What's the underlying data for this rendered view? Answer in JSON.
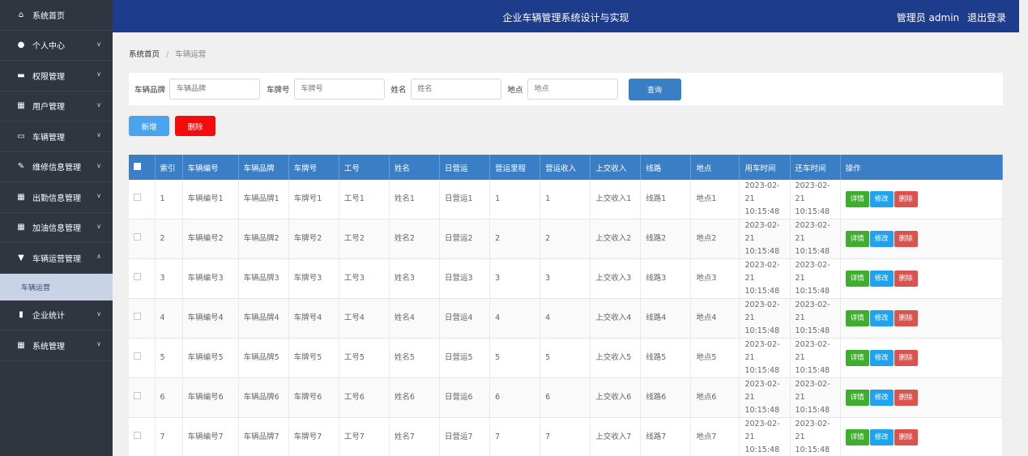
{
  "sidebar": {
    "items": [
      {
        "label": "系统首页",
        "icon": "home-icon",
        "glyph": "⌂",
        "expandable": false
      },
      {
        "label": "个人中心",
        "icon": "user-icon",
        "glyph": "●",
        "expandable": true
      },
      {
        "label": "权限管理",
        "icon": "monitor-icon",
        "glyph": "▬",
        "expandable": true
      },
      {
        "label": "用户管理",
        "icon": "grid-icon",
        "glyph": "▦",
        "expandable": true
      },
      {
        "label": "车辆管理",
        "icon": "car-icon",
        "glyph": "▭",
        "expandable": true
      },
      {
        "label": "维修信息管理",
        "icon": "clipboard-icon",
        "glyph": "✎",
        "expandable": true
      },
      {
        "label": "出勤信息管理",
        "icon": "grid-icon",
        "glyph": "▦",
        "expandable": true
      },
      {
        "label": "加油信息管理",
        "icon": "grid-icon",
        "glyph": "▦",
        "expandable": true
      },
      {
        "label": "车辆运营管理",
        "icon": "funnel-icon",
        "glyph": "▼",
        "expandable": true,
        "open": true
      }
    ],
    "sub_item": "车辆运营",
    "items_after": [
      {
        "label": "企业统计",
        "icon": "bar-chart-icon",
        "glyph": "▮",
        "expandable": true
      },
      {
        "label": "系统管理",
        "icon": "table-icon",
        "glyph": "▦",
        "expandable": true
      }
    ]
  },
  "header": {
    "title": "企业车辆管理系统设计与实现",
    "admin_label": "管理员 admin",
    "logout_label": "退出登录"
  },
  "breadcrumb": {
    "home": "系统首页",
    "separator": "/",
    "current": "车辆运营"
  },
  "filter": {
    "fields": [
      {
        "label": "车辆品牌",
        "placeholder": "车辆品牌"
      },
      {
        "label": "车牌号",
        "placeholder": "车牌号"
      },
      {
        "label": "姓名",
        "placeholder": "姓名"
      },
      {
        "label": "地点",
        "placeholder": "地点"
      }
    ],
    "search_label": "查询"
  },
  "actions": {
    "add_label": "新增",
    "delete_label": "删除"
  },
  "table": {
    "columns": [
      "索引",
      "车辆编号",
      "车辆品牌",
      "车牌号",
      "工号",
      "姓名",
      "日营运",
      "营运里程",
      "营运收入",
      "上交收入",
      "线路",
      "地点",
      "用车时间",
      "还车时间",
      "操作"
    ],
    "rows": [
      [
        "1",
        "车辆编号1",
        "车辆品牌1",
        "车牌号1",
        "工号1",
        "姓名1",
        "日营运1",
        "1",
        "1",
        "上交收入1",
        "线路1",
        "地点1",
        "2023-02-21 10:15:48",
        "2023-02-21 10:15:48"
      ],
      [
        "2",
        "车辆编号2",
        "车辆品牌2",
        "车牌号2",
        "工号2",
        "姓名2",
        "日营运2",
        "2",
        "2",
        "上交收入2",
        "线路2",
        "地点2",
        "2023-02-21 10:15:48",
        "2023-02-21 10:15:48"
      ],
      [
        "3",
        "车辆编号3",
        "车辆品牌3",
        "车牌号3",
        "工号3",
        "姓名3",
        "日营运3",
        "3",
        "3",
        "上交收入3",
        "线路3",
        "地点3",
        "2023-02-21 10:15:48",
        "2023-02-21 10:15:48"
      ],
      [
        "4",
        "车辆编号4",
        "车辆品牌4",
        "车牌号4",
        "工号4",
        "姓名4",
        "日营运4",
        "4",
        "4",
        "上交收入4",
        "线路4",
        "地点4",
        "2023-02-21 10:15:48",
        "2023-02-21 10:15:48"
      ],
      [
        "5",
        "车辆编号5",
        "车辆品牌5",
        "车牌号5",
        "工号5",
        "姓名5",
        "日营运5",
        "5",
        "5",
        "上交收入5",
        "线路5",
        "地点5",
        "2023-02-21 10:15:48",
        "2023-02-21 10:15:48"
      ],
      [
        "6",
        "车辆编号6",
        "车辆品牌6",
        "车牌号6",
        "工号6",
        "姓名6",
        "日营运6",
        "6",
        "6",
        "上交收入6",
        "线路6",
        "地点6",
        "2023-02-21 10:15:48",
        "2023-02-21 10:15:48"
      ],
      [
        "7",
        "车辆编号7",
        "车辆品牌7",
        "车牌号7",
        "工号7",
        "姓名7",
        "日营运7",
        "7",
        "7",
        "上交收入7",
        "线路7",
        "地点7",
        "2023-02-21 10:15:48",
        "2023-02-21 10:15:48"
      ]
    ],
    "row_actions": {
      "detail": "详情",
      "edit": "修改",
      "delete": "删除"
    }
  },
  "colors": {
    "header_bg": "#1e3c8c",
    "sidebar_bg": "#2f3640",
    "table_header_bg": "#3a7ec5",
    "add_button": "#4aa3ef",
    "delete_button": "#f20c0c",
    "detail_button": "#3fae2f",
    "edit_button": "#1fa3f0",
    "row_delete_button": "#d9534f"
  }
}
